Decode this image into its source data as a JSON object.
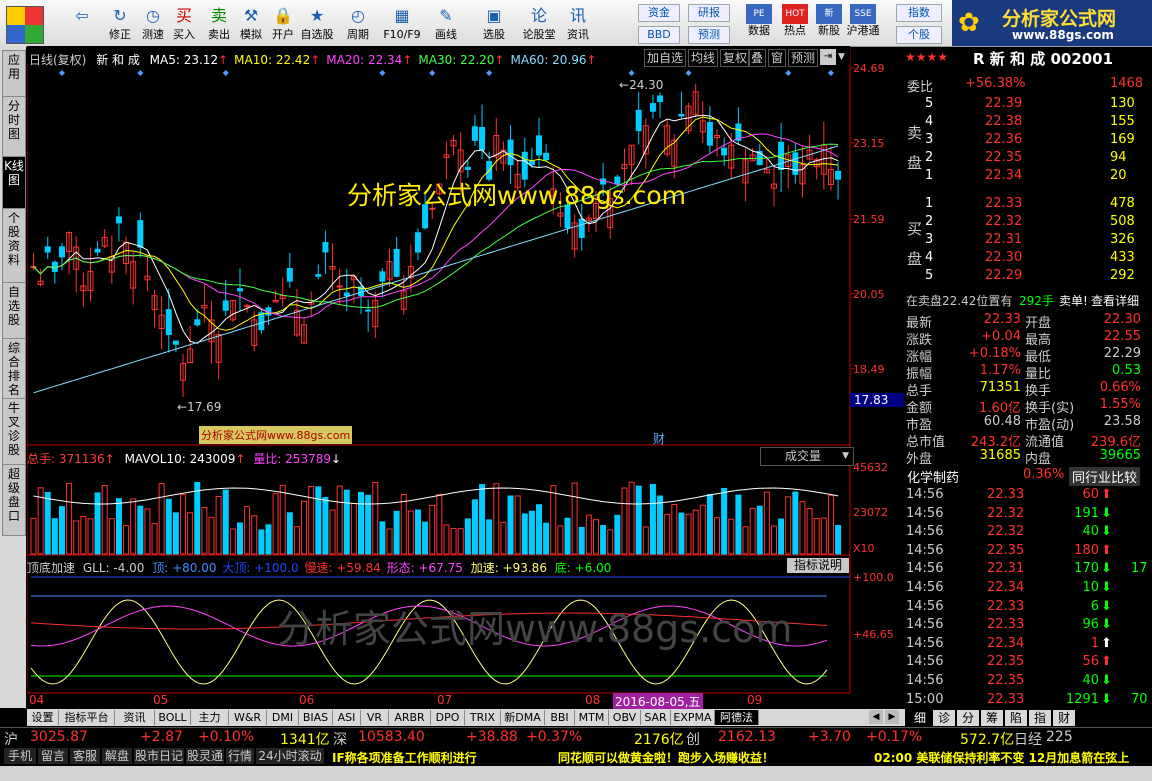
{
  "toolbar": {
    "buttons": [
      {
        "label": "",
        "icon": "back-arrow-icon",
        "glyph": "⇦"
      },
      {
        "label": "修正",
        "icon": "refresh-icon",
        "glyph": "↻"
      },
      {
        "label": "测速",
        "icon": "clock-icon",
        "glyph": "◷"
      },
      {
        "label": "买入",
        "icon": "buy-icon",
        "glyph": "买"
      },
      {
        "label": "卖出",
        "icon": "sell-icon",
        "glyph": "卖"
      },
      {
        "label": "模拟",
        "icon": "hammer-icon",
        "glyph": "⚒"
      },
      {
        "label": "开户",
        "icon": "lock-icon",
        "glyph": "🔒"
      },
      {
        "label": "自选股",
        "icon": "star-icon",
        "glyph": "★"
      },
      {
        "label": "周期",
        "icon": "period-icon",
        "glyph": "◴"
      },
      {
        "label": "F10/F9",
        "icon": "f10-icon",
        "glyph": "▦"
      },
      {
        "label": "画线",
        "icon": "pen-icon",
        "glyph": "✎"
      },
      {
        "label": "选股",
        "icon": "select-stock-icon",
        "glyph": "▣"
      },
      {
        "label": "论股堂",
        "icon": "forum-icon",
        "glyph": "论"
      },
      {
        "label": "资讯",
        "icon": "news-icon",
        "glyph": "讯"
      }
    ],
    "small_buttons": [
      "资金",
      "研报",
      "BBD",
      "预测"
    ],
    "right_buttons": [
      {
        "label": "数据",
        "icon": "pe-icon",
        "glyph": "PE"
      },
      {
        "label": "热点",
        "icon": "hot-icon",
        "glyph": "HOT"
      },
      {
        "label": "新股",
        "icon": "new-stock-icon",
        "glyph": "新"
      },
      {
        "label": "沪港通",
        "icon": "sse-hkex-icon",
        "glyph": "SSE"
      }
    ],
    "index_buttons": [
      "指数",
      "个股"
    ]
  },
  "brand": {
    "title": "分析家公式网",
    "url": "www.88gs.com"
  },
  "side_tabs": [
    "应用",
    "分时图",
    "K线图",
    "个股资料",
    "自选股",
    "综合排名",
    "牛叉诊股",
    "超级盘口"
  ],
  "chart_header": {
    "title": "日线(复权)",
    "stock": "新 和 成",
    "ma": [
      {
        "label": "MA5: 23.12",
        "color": "#ffffff"
      },
      {
        "label": "MA10: 22.42",
        "color": "#ffff00"
      },
      {
        "label": "MA20: 22.34",
        "color": "#ff44ff"
      },
      {
        "label": "MA30: 22.20",
        "color": "#44ff44"
      },
      {
        "label": "MA60: 20.96",
        "color": "#88ddff"
      }
    ],
    "buttons": [
      "加自选",
      "均线",
      "复权",
      "叠",
      "窗",
      "预测"
    ]
  },
  "price_axis": [
    "24.69",
    "23.15",
    "21.59",
    "20.05",
    "18.49"
  ],
  "current_price_tag": "17.83",
  "high_label": "24.30",
  "low_label": "17.69",
  "watermark": "分析家公式网www.88gs.com",
  "watermark_small": "分析家公式网www.88gs.com",
  "cai_label": "财",
  "volume": {
    "total_label": "总手: 371136",
    "mavol": "MAVOL10: 243009",
    "ratio": "量比: 253789",
    "selector": "成交量",
    "axis": [
      "45632",
      "23072"
    ],
    "unit": "X10"
  },
  "indicator": {
    "name": "顶底加速",
    "gll": "GLL: -4.00",
    "ding": "顶: +80.00",
    "dading": "大顶: +100.0",
    "mansu": "慢速: +59.84",
    "xingtai": "形态: +67.75",
    "jiasu": "加速: +93.86",
    "di": "底: +6.00",
    "help": "指标说明",
    "axis": [
      "+100.0",
      "+46.65"
    ],
    "watermark": "分析家公式网www.88gs.com"
  },
  "months": [
    "04",
    "05",
    "06",
    "07",
    "08",
    "09"
  ],
  "date_tag": "2016-08-05,五",
  "quote": {
    "stars": "★★★★",
    "stock_title": "R 新 和 成 002001",
    "weibi_label": "委比",
    "weibi_pct": "+56.38%",
    "weibi_num": "1468",
    "sell_side_label": "卖盘",
    "buy_side_label": "买盘",
    "sell": [
      {
        "lvl": "5",
        "price": "22.39",
        "vol": "130"
      },
      {
        "lvl": "4",
        "price": "22.38",
        "vol": "155"
      },
      {
        "lvl": "3",
        "price": "22.36",
        "vol": "169"
      },
      {
        "lvl": "2",
        "price": "22.35",
        "vol": "94"
      },
      {
        "lvl": "1",
        "price": "22.34",
        "vol": "20"
      }
    ],
    "buy": [
      {
        "lvl": "1",
        "price": "22.33",
        "vol": "478"
      },
      {
        "lvl": "2",
        "price": "22.32",
        "vol": "508"
      },
      {
        "lvl": "3",
        "price": "22.31",
        "vol": "326"
      },
      {
        "lvl": "4",
        "price": "22.30",
        "vol": "433"
      },
      {
        "lvl": "5",
        "price": "22.29",
        "vol": "292"
      }
    ],
    "position_info": "在卖盘22.42位置有",
    "position_vol": "292手",
    "position_action": "卖单!",
    "view_detail": "查看详细",
    "stats": [
      [
        "最新",
        "22.33",
        "开盘",
        "22.30"
      ],
      [
        "涨跌",
        "+0.04",
        "最高",
        "22.55"
      ],
      [
        "涨幅",
        "+0.18%",
        "最低",
        "22.29"
      ],
      [
        "振幅",
        "1.17%",
        "量比",
        "0.53"
      ],
      [
        "总手",
        "71351",
        "换手",
        "0.66%"
      ],
      [
        "金额",
        "1.60亿",
        "换手(实)",
        "1.55%"
      ],
      [
        "市盈",
        "60.48",
        "市盈(动)",
        "23.58"
      ],
      [
        "总市值",
        "243.2亿",
        "流通值",
        "239.6亿"
      ],
      [
        "外盘",
        "31685",
        "内盘",
        "39665"
      ]
    ],
    "industry": "化学制药",
    "industry_pct": "0.36%",
    "peer_compare": "同行业比较",
    "ticks": [
      [
        "14:56",
        "22.33",
        "60",
        "up"
      ],
      [
        "14:56",
        "22.32",
        "191",
        "down"
      ],
      [
        "14:56",
        "22.32",
        "40",
        "down"
      ],
      [
        "14:56",
        "22.35",
        "180",
        "up"
      ],
      [
        "14:56",
        "22.31",
        "170",
        "down"
      ],
      [
        "14:56",
        "22.34",
        "10",
        "down"
      ],
      [
        "14:56",
        "22.33",
        "6",
        "down"
      ],
      [
        "14:56",
        "22.33",
        "96",
        "down"
      ],
      [
        "14:56",
        "22.34",
        "1",
        "up"
      ],
      [
        "14:56",
        "22.35",
        "56",
        "up"
      ],
      [
        "14:56",
        "22.35",
        "40",
        "down"
      ],
      [
        "15:00",
        "22.33",
        "1291",
        "down"
      ]
    ],
    "tick_extra": [
      "",
      "",
      "",
      "",
      "17",
      "",
      "",
      "",
      "",
      "",
      "",
      "70"
    ],
    "tabs": [
      "细",
      "诊",
      "分",
      "筹",
      "陷",
      "指",
      "财"
    ]
  },
  "bottom_tabs": [
    "设置",
    "指标平台",
    "资讯",
    "BOLL",
    "主力",
    "W&R",
    "DMI",
    "BIAS",
    "ASI",
    "VR",
    "ARBR",
    "DPO",
    "TRIX",
    "新DMA",
    "BBI",
    "MTM",
    "OBV",
    "SAR",
    "EXPMA",
    "阿德法"
  ],
  "ticker": {
    "sh_label": "沪",
    "sh_val": "3025.87",
    "sh_chg": "+2.87",
    "sh_pct": "+0.10%",
    "sh_amt": "1341亿",
    "sz_label": "深",
    "sz_val": "10583.40",
    "sz_chg": "+38.88",
    "sz_pct": "+0.37%",
    "sz_amt": "2176亿",
    "cy_label": "创",
    "cy_val": "2162.13",
    "cy_chg": "+3.70",
    "cy_pct": "+0.17%",
    "cy_amt": "572.7亿",
    "nk_label": "日经",
    "nk_val": "225"
  },
  "statusbar": {
    "buttons": [
      "手机",
      "留言",
      "客服",
      "解盘",
      "股市日记",
      "股灵通",
      "行情",
      "24小时滚动"
    ],
    "news1": "IF称各项准备工作顺利进行",
    "news2": "同花顺可以做黄金啦！跑步入场赚收益！",
    "news3": "02:00 美联储保持利率不变 12月加息箭在弦上"
  },
  "colors": {
    "up": "#ff3030",
    "down": "#00ccff",
    "axis": "#c00000",
    "yellow": "#ffff00",
    "green": "#00ff00",
    "ma5": "#ffffff",
    "ma10": "#ffff00",
    "ma20": "#ff44ff",
    "ma30": "#44ff44",
    "ma60": "#88ddff"
  }
}
